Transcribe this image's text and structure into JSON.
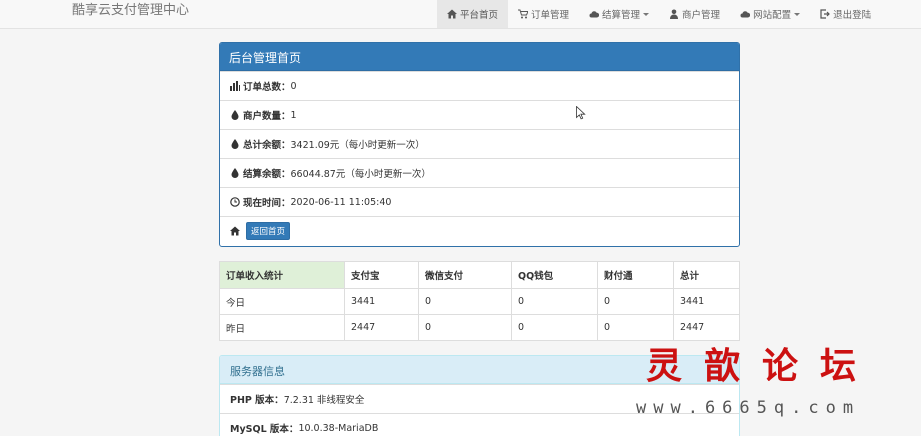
{
  "brand": "酷享云支付管理中心",
  "nav": {
    "home": "平台首页",
    "orders": "订单管理",
    "settlement": "结算管理",
    "merchants": "商户管理",
    "site_config": "网站配置",
    "logout": "退出登陆"
  },
  "dashboard": {
    "title": "后台管理首页",
    "order_total_label": "订单总数：",
    "order_total_value": "0",
    "merchant_count_label": "商户数量：",
    "merchant_count_value": "1",
    "total_balance_label": "总计余额：",
    "total_balance_value": "3421.09元（每小时更新一次）",
    "settle_balance_label": "结算余额：",
    "settle_balance_value": "66044.87元（每小时更新一次）",
    "now_label": "现在时间：",
    "now_value": "2020-06-11 11:05:40",
    "back_button": "返回首页"
  },
  "stats": {
    "headers": [
      "订单收入统计",
      "支付宝",
      "微信支付",
      "QQ钱包",
      "财付通",
      "总计"
    ],
    "rows": [
      [
        "今日",
        "3441",
        "0",
        "0",
        "0",
        "3441"
      ],
      [
        "昨日",
        "2447",
        "0",
        "0",
        "0",
        "2447"
      ]
    ]
  },
  "server": {
    "title": "服务器信息",
    "php_label": "PHP 版本：",
    "php_value": "7.2.31 非线程安全",
    "mysql_label": "MySQL 版本：",
    "mysql_value": "10.0.38-MariaDB"
  },
  "watermark": {
    "title": "灵歆论坛",
    "url": "www.6665q.com"
  },
  "colors": {
    "primary": "#337ab7",
    "success_bg": "#dff0d8",
    "info_bg": "#d9edf7",
    "watermark": "#cc1111"
  }
}
